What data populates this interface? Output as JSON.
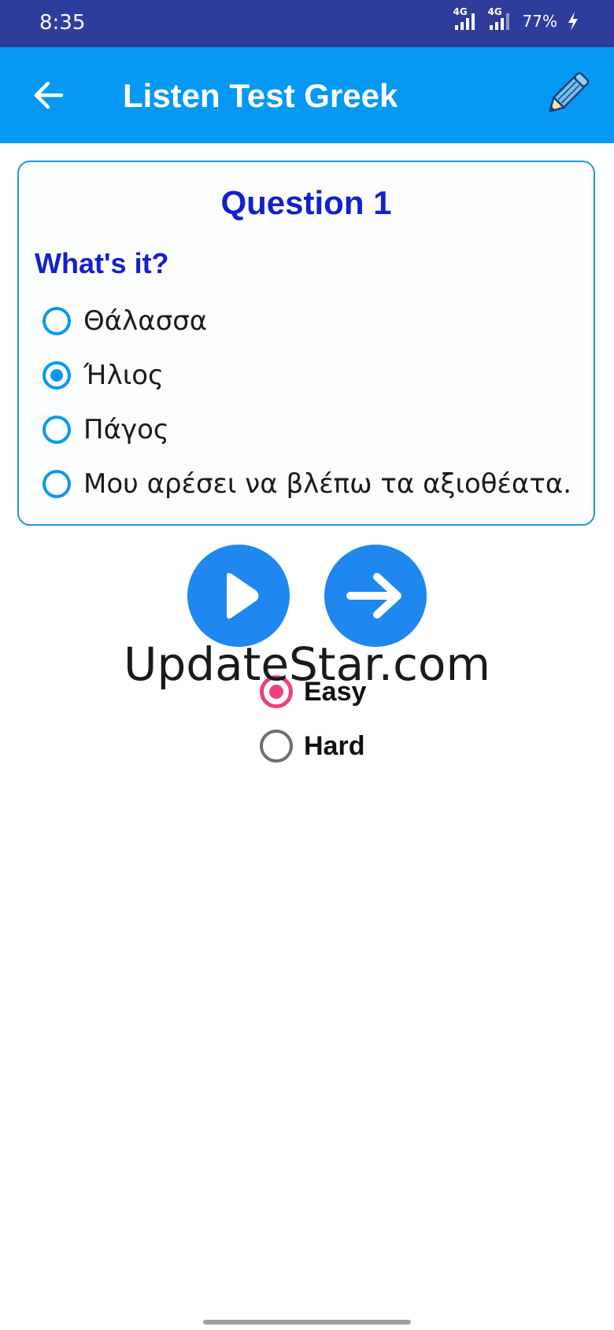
{
  "status_bar": {
    "time": "8:35",
    "network_1": "4G",
    "network_2": "4G",
    "battery": "77%",
    "icons": [
      "signal-icon",
      "signal-icon",
      "battery-charging-icon"
    ]
  },
  "app_bar": {
    "title": "Listen Test Greek",
    "back_icon": "arrow-left-icon",
    "edit_icon": "pencil-icon"
  },
  "question": {
    "number_label": "Question 1",
    "prompt": "What's it?",
    "options": [
      {
        "label": "Θάλασσα",
        "selected": false
      },
      {
        "label": "Ήλιος",
        "selected": true
      },
      {
        "label": "Πάγος",
        "selected": false
      },
      {
        "label": "Μου αρέσει να βλέπω τα αξιοθέατα.",
        "selected": false
      }
    ]
  },
  "controls": {
    "play_icon": "play-icon",
    "next_icon": "arrow-right-icon"
  },
  "watermark": "UpdateStar.com",
  "difficulty": {
    "options": [
      {
        "label": "Easy",
        "selected": true
      },
      {
        "label": "Hard",
        "selected": false
      }
    ]
  },
  "colors": {
    "status_bar": "#2e3c9c",
    "app_bar": "#0599f4",
    "question_text": "#1320cc",
    "radio_accent": "#0d98ec",
    "circle_button": "#1e87f0",
    "difficulty_accent": "#f0417a"
  }
}
